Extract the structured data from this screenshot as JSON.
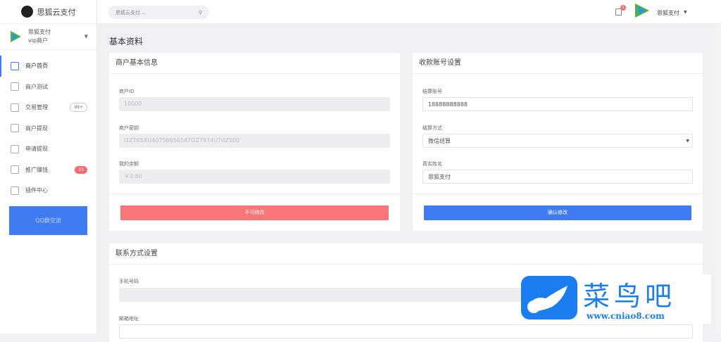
{
  "brand": "思狐云支付",
  "user": {
    "name": "思狐支付",
    "level": "vip商户"
  },
  "nav": [
    {
      "label": "商户首页"
    },
    {
      "label": "商户测试"
    },
    {
      "label": "交易管理",
      "badge": "99+"
    },
    {
      "label": "商户提现"
    },
    {
      "label": "申请提现"
    },
    {
      "label": "推广赚钱",
      "badge": "23"
    },
    {
      "label": "插件中心"
    }
  ],
  "qq_button": "QQ群交流",
  "header": {
    "search_placeholder": "思狐云支付...",
    "notification_count": "1",
    "username": "思狐支付"
  },
  "page_title": "基本资料",
  "basic": {
    "title": "商户基本信息",
    "fields": [
      {
        "label": "商户ID",
        "value": "10000"
      },
      {
        "label": "商户密钥",
        "value": "i1ZT65XU40756656547OZ7974U7dZ500"
      },
      {
        "label": "我的余额",
        "value": "￥0.60"
      }
    ],
    "button": "不可修改"
  },
  "account": {
    "title": "收款账号设置",
    "fields": [
      {
        "label": "结算账号",
        "value": "18888888888"
      },
      {
        "label": "结算方式",
        "value": "微信结算"
      },
      {
        "label": "真实姓名",
        "value": "思狐支付"
      }
    ],
    "button": "确认修改"
  },
  "contact": {
    "title": "联系方式设置",
    "fields": [
      {
        "label": "手机号码",
        "value": ""
      },
      {
        "label": "邮箱地址",
        "value": ""
      }
    ]
  },
  "watermark": {
    "text": "菜鸟吧",
    "url": "www.cniao8.com"
  },
  "colors": {
    "primary": "#3f7cf4",
    "danger": "#f87578"
  }
}
